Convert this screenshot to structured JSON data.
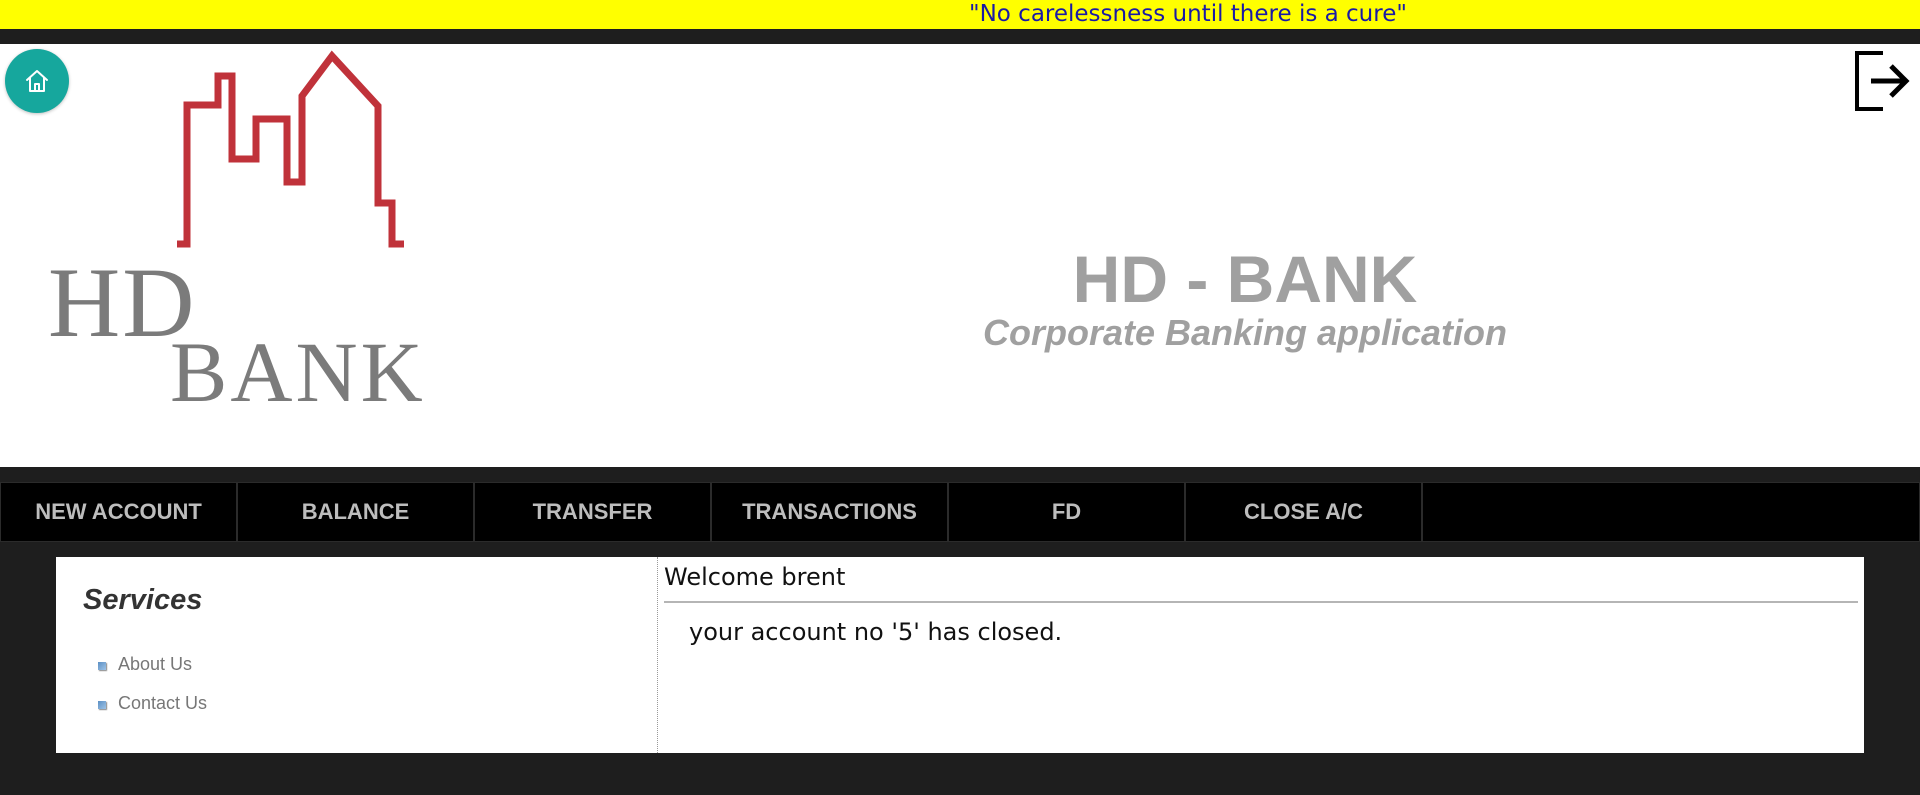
{
  "marquee": {
    "text": "\"No carelessness until there is a cure\""
  },
  "header": {
    "logo": {
      "line1": "HD",
      "line2": "BANK"
    },
    "title": "HD - BANK",
    "subtitle": "Corporate Banking application"
  },
  "nav": {
    "items": [
      "NEW ACCOUNT",
      "BALANCE",
      "TRANSFER",
      "TRANSACTIONS",
      "FD",
      "CLOSE A/C"
    ]
  },
  "sidebar": {
    "title": "Services",
    "links": [
      "About Us",
      "Contact Us"
    ]
  },
  "main": {
    "welcome": "Welcome brent",
    "message": "your account no '5' has closed."
  },
  "colors": {
    "marquee_bg": "#ffff00",
    "marquee_text": "#1a1aa6",
    "home_button": "#16a79d",
    "logo_red": "#c0323a",
    "nav_bg": "#000000",
    "page_bg": "#1e1e1e"
  },
  "icons": {
    "home": "home-icon",
    "exit": "logout-icon",
    "bullet": "bullet-icon"
  }
}
